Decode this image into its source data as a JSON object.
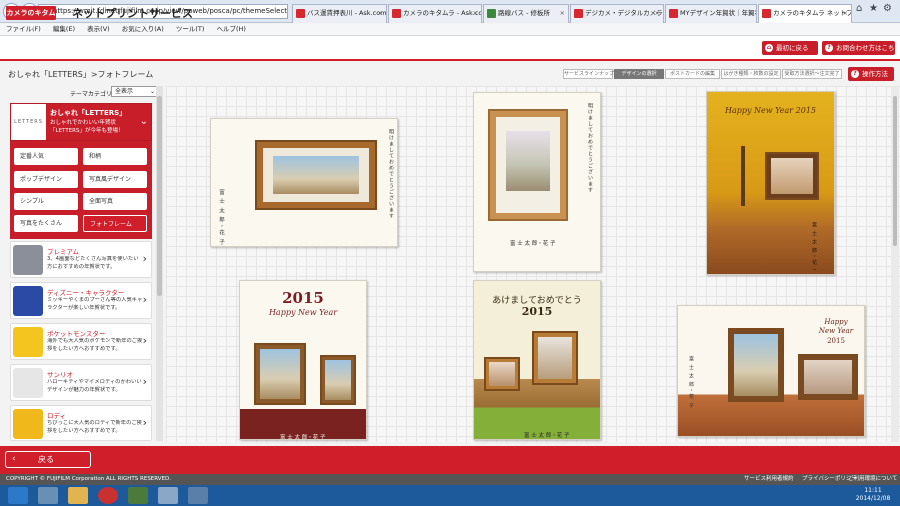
{
  "browser": {
    "url": "https://wmit.fdinet.fujifilm.co.jp/view/poweb/posca/pc/themeSelect.html",
    "tabs": [
      {
        "label": "バス運賃押表川 - Ask.com S..."
      },
      {
        "label": "カメラのキタムラ - Ask.com Se..."
      },
      {
        "label": "路線バス - 修板所"
      },
      {
        "label": "デジカメ・デジタルカメラのことなら..."
      },
      {
        "label": "MYデザイン年賀状｜年賀状..."
      },
      {
        "label": "カメラのキタムラ ネットプリント..."
      }
    ],
    "menu": [
      "ファイル(F)",
      "編集(E)",
      "表示(V)",
      "お気に入り(A)",
      "ツール(T)",
      "ヘルプ(H)"
    ]
  },
  "header": {
    "logo": "カメラのキタムラ",
    "service": "ネットプリントサービス",
    "btn_back": "最初に戻る",
    "btn_contact": "お問合わせ方はこちら"
  },
  "crumb": "おしゃれ「LETTERS」>フォトフレーム",
  "steps": [
    "サービスラインナップ",
    "デザインの選択",
    "ポストカードの編集",
    "はがき種類・枚数の設定",
    "受取方法選択～注文完了"
  ],
  "help_btn": "操作方法",
  "category": {
    "label": "テーマカテゴリ",
    "value": "全表示"
  },
  "letters": {
    "logo": "LETTERS",
    "title": "おしゃれ「LETTERS」",
    "desc": "おしゃれでかわいい年賀状「LETTERS」が今年も登場！"
  },
  "subs": [
    "定番人気",
    "和柄",
    "ポップデザイン",
    "写真風デザイン",
    "シンプル",
    "全面写真",
    "写真をたくさん",
    "フォトフレーム"
  ],
  "cats": [
    {
      "name": "プレミアム",
      "desc": "3、4画面などたくさん写真を使いたい方におすすめの年賀状です。"
    },
    {
      "name": "ディズニー・キャラクター",
      "desc": "ミッキーやくまのプーさん等の人気キャラクターが楽しい年賀状です。"
    },
    {
      "name": "ポケットモンスター",
      "desc": "海外でも大人気のポケモンで新年のご挨拶をしたい方へおすすめです。"
    },
    {
      "name": "サンリオ",
      "desc": "ハローキティやマイメロディのかわいいデザインが魅力の年賀状です。"
    },
    {
      "name": "ロディ",
      "desc": "ちびっこに大人気のロディで新年のご挨拶をしたい方へおすすめです。"
    }
  ],
  "cards": {
    "c3_title": "Happy New Year 2015",
    "c4_year": "2015",
    "c4_sub": "Happy New Year",
    "c5_title": "あけましておめでとう",
    "c5_year": "2015",
    "c6_line1": "Happy",
    "c6_line2": "New Year",
    "c6_year": "2015",
    "names": "富 士 太 郎・花 子",
    "greet": "明けましておめでとうございます"
  },
  "back_btn": "戻る",
  "footer": {
    "copyright": "COPYRIGHT © FUJIFILM Corporation ALL RIGHTS RESERVED.",
    "links": [
      "サービス利用者規約",
      "プライバシーポリシー",
      "ご利用環境について"
    ]
  },
  "clock": {
    "time": "11:11",
    "date": "2014/12/08"
  }
}
